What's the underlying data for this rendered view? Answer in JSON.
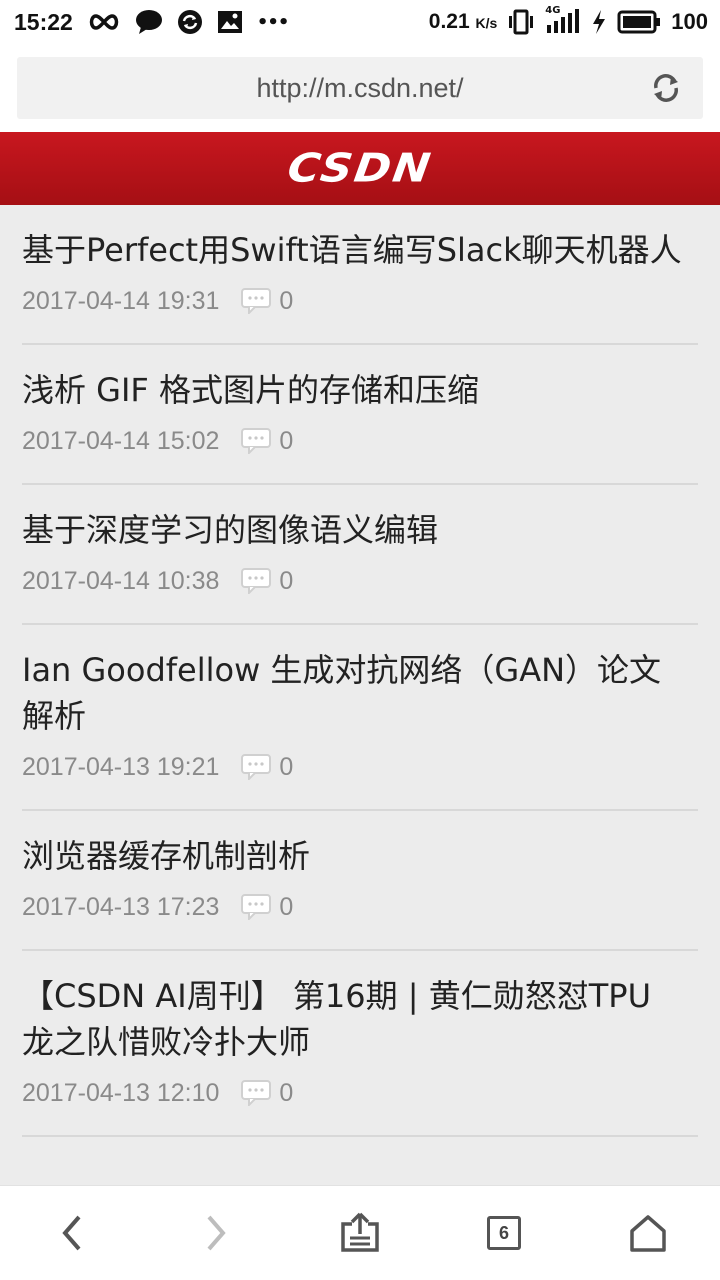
{
  "status_bar": {
    "time": "15:22",
    "more_icon": "•••",
    "speed_value": "0.21",
    "speed_unit": "K/s",
    "network_label": "4G",
    "battery_level": "100"
  },
  "browser": {
    "url": "http://m.csdn.net/"
  },
  "site": {
    "logo_text": "CSDN",
    "brand_color": "#b5121b"
  },
  "articles": [
    {
      "title": "基于Perfect用Swift语言编写Slack聊天机器人",
      "date": "2017-04-14 19:31",
      "comments": "0"
    },
    {
      "title": "浅析 GIF 格式图片的存储和压缩",
      "date": "2017-04-14 15:02",
      "comments": "0"
    },
    {
      "title": "基于深度学习的图像语义编辑",
      "date": "2017-04-14 10:38",
      "comments": "0"
    },
    {
      "title": "Ian Goodfellow 生成对抗网络（GAN）论文解析",
      "date": "2017-04-13 19:21",
      "comments": "0"
    },
    {
      "title": "浏览器缓存机制剖析",
      "date": "2017-04-13 17:23",
      "comments": "0"
    },
    {
      "title": "【CSDN AI周刊】 第16期 | 黄仁勋怒怼TPU 龙之队惜败冷扑大师",
      "date": "2017-04-13 12:10",
      "comments": "0"
    }
  ],
  "bottom_nav": {
    "tab_count": "6",
    "icons": [
      "back-icon",
      "forward-icon",
      "share-icon",
      "tabs-icon",
      "home-icon"
    ]
  }
}
